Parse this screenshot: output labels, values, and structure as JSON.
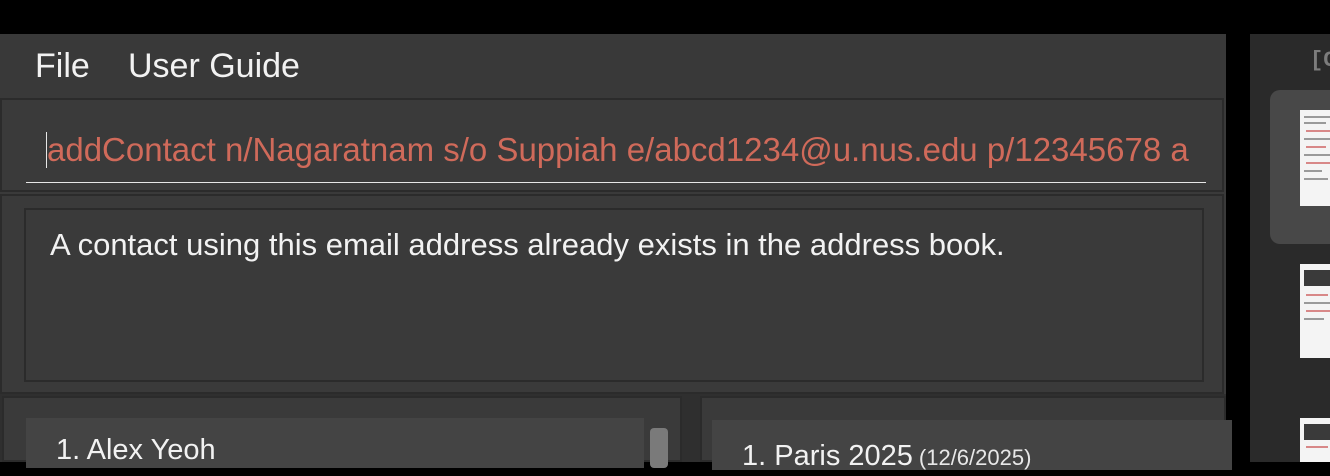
{
  "menu": {
    "file": "File",
    "user_guide": "User Guide"
  },
  "command": {
    "value": "addContact n/Nagaratnam s/o Suppiah e/abcd1234@u.nus.edu p/12345678 a"
  },
  "result": {
    "message": "A contact using this email address already exists in the address book."
  },
  "persons": [
    {
      "label": "1. Alex Yeoh"
    }
  ],
  "trips": [
    {
      "label": "1.  Paris 2025",
      "date": "(12/6/2025)"
    }
  ],
  "sidebar": {
    "header": "[C"
  },
  "colors": {
    "command_error_text": "#d06a5a",
    "background": "#3a3a3a"
  }
}
